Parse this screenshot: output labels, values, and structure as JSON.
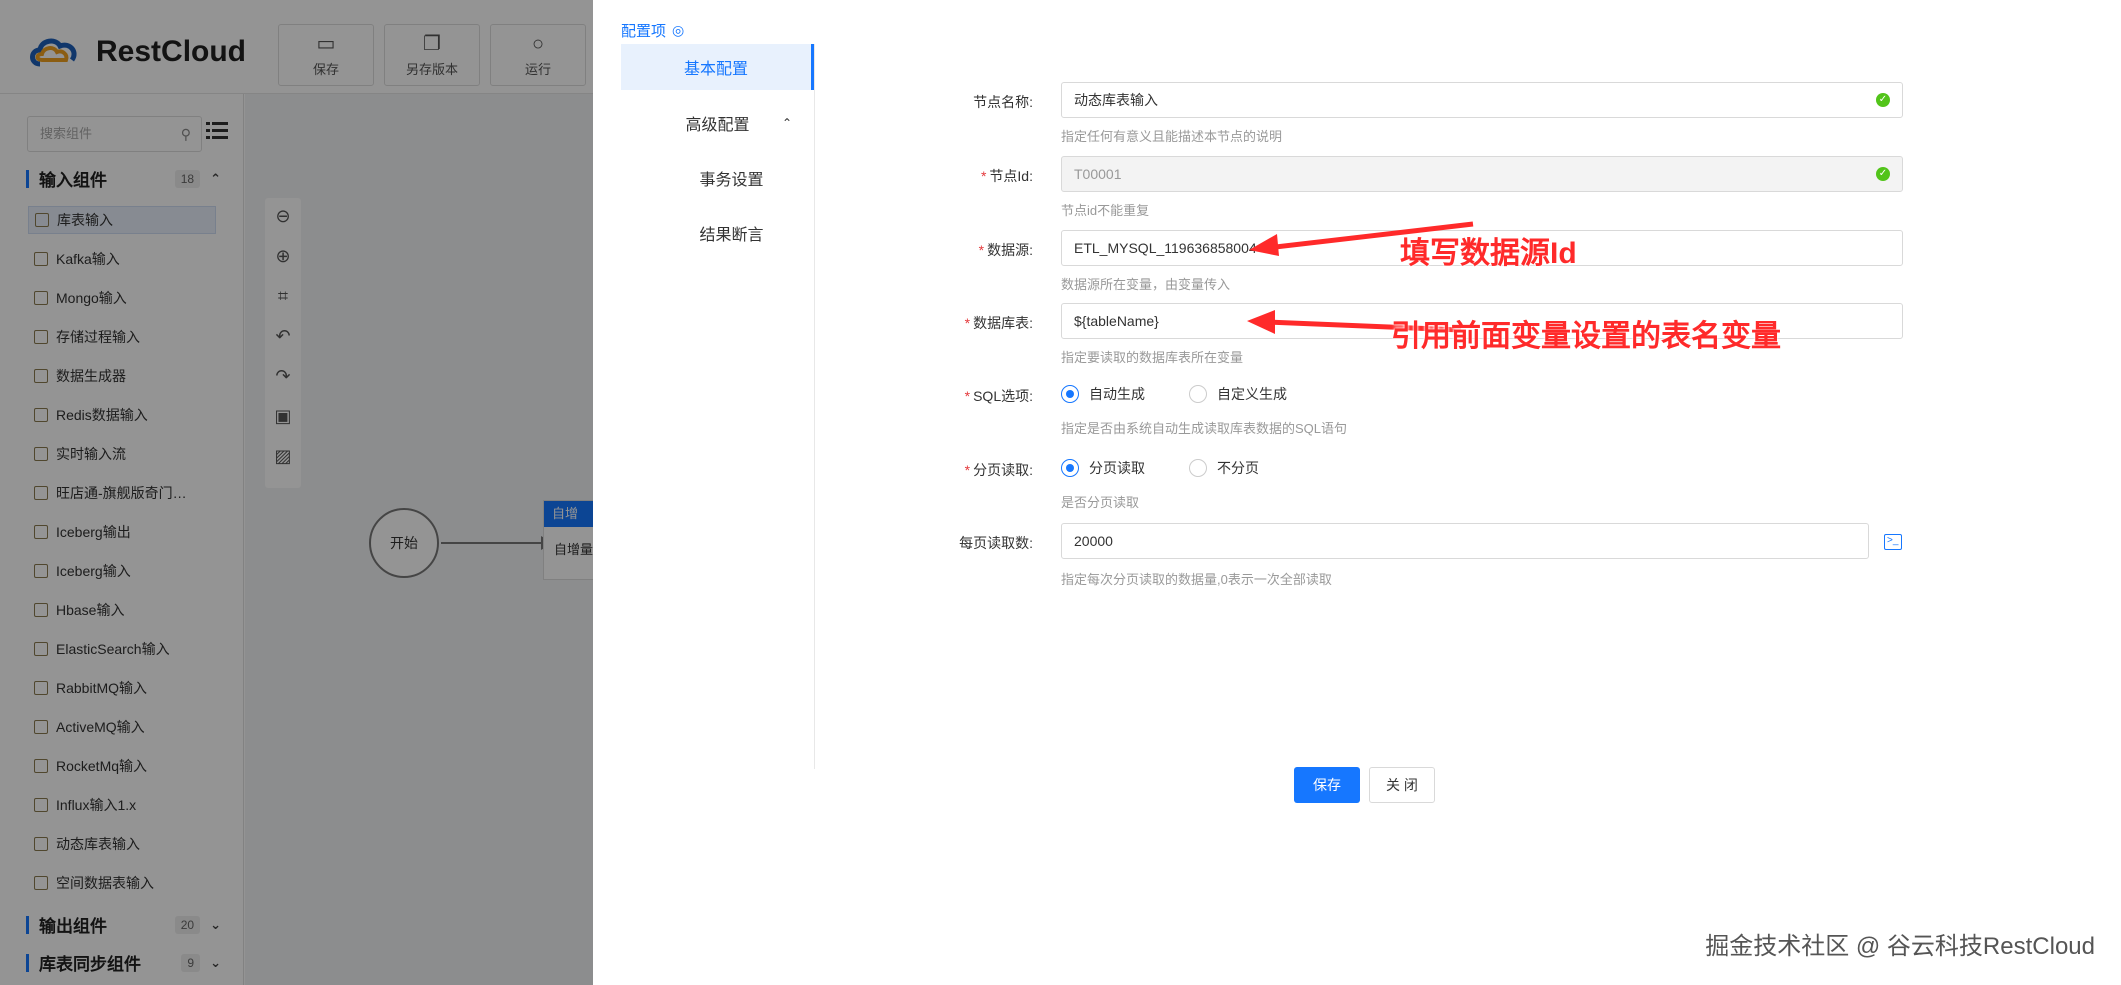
{
  "app": {
    "logo_text": "RestCloud",
    "toolbar": [
      {
        "label": "保存",
        "icon": "save-icon"
      },
      {
        "label": "另存版本",
        "icon": "copy-icon"
      },
      {
        "label": "运行",
        "icon": "run-icon"
      }
    ],
    "search_placeholder": "搜索组件",
    "groups": [
      {
        "label": "输入组件",
        "count": "18"
      },
      {
        "label": "输出组件",
        "count": "20"
      },
      {
        "label": "库表同步组件",
        "count": "9"
      }
    ],
    "components": [
      "库表输入",
      "Kafka输入",
      "Mongo输入",
      "存储过程输入",
      "数据生成器",
      "Redis数据输入",
      "实时输入流",
      "旺店通-旗舰版奇门…",
      "Iceberg输出",
      "Iceberg输入",
      "Hbase输入",
      "ElasticSearch输入",
      "RabbitMQ输入",
      "ActiveMQ输入",
      "RocketMq输入",
      "Influx输入1.x",
      "动态库表输入",
      "空间数据表输入"
    ],
    "canvas": {
      "start_label": "开始",
      "node_head": "自增",
      "node_body": "自增量"
    }
  },
  "drawer": {
    "title": "配置项",
    "nav": [
      "基本配置",
      "高级配置",
      "事务设置",
      "结果断言"
    ],
    "fields": {
      "node_name": {
        "label": "节点名称:",
        "value": "动态库表输入",
        "help": "指定任何有意义且能描述本节点的说明"
      },
      "node_id": {
        "label": "节点Id:",
        "value": "T00001",
        "help": "节点id不能重复"
      },
      "datasource": {
        "label": "数据源:",
        "value": "ETL_MYSQL_119636858004",
        "help": "数据源所在变量，由变量传入"
      },
      "db_table": {
        "label": "数据库表:",
        "value": "${tableName}",
        "help": "指定要读取的数据库表所在变量"
      },
      "sql_option": {
        "label": "SQL选项:",
        "options": [
          "自动生成",
          "自定义生成"
        ],
        "help": "指定是否由系统自动生成读取库表数据的SQL语句"
      },
      "paging": {
        "label": "分页读取:",
        "options": [
          "分页读取",
          "不分页"
        ],
        "help": "是否分页读取"
      },
      "page_size": {
        "label": "每页读取数:",
        "value": "20000",
        "help": "指定每次分页读取的数据量,0表示一次全部读取"
      }
    },
    "annotations": {
      "datasource": "填写数据源Id",
      "table": "引用前面变量设置的表名变量"
    },
    "buttons": {
      "save": "保存",
      "close": "关 闭"
    }
  },
  "watermark": "掘金技术社区 @ 谷云科技RestCloud",
  "colors": {
    "accent": "#1677ff",
    "annotation": "#ff2a2a",
    "success": "#52c41a",
    "required": "#e4393c"
  }
}
